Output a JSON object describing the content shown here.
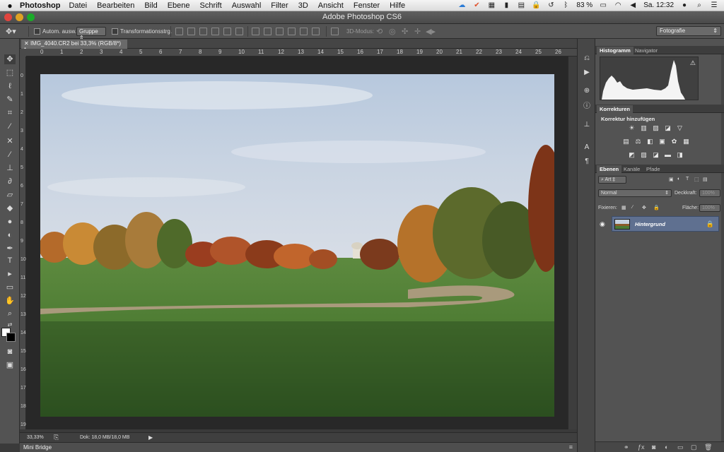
{
  "menubar": {
    "app_name": "Photoshop",
    "items": [
      "Datei",
      "Bearbeiten",
      "Bild",
      "Ebene",
      "Schrift",
      "Auswahl",
      "Filter",
      "3D",
      "Ansicht",
      "Fenster",
      "Hilfe"
    ],
    "battery": "83 %",
    "clock": "Sa. 12:32"
  },
  "titlebar": {
    "title": "Adobe Photoshop CS6"
  },
  "options": {
    "auto_select_label": "Autom. ausw.:",
    "auto_select_mode": "Gruppe",
    "transform_label": "Transformationsstrg.",
    "mode_3d_label": "3D-Modus:",
    "workspace": "Fotografie"
  },
  "document": {
    "tab_title": "IMG_4040.CR2 bei 33,3% (RGB/8*) *",
    "ruler_marks": [
      "0",
      "1",
      "2",
      "3",
      "4",
      "5",
      "6",
      "7",
      "8",
      "9",
      "10",
      "11",
      "12",
      "13",
      "14",
      "15",
      "16",
      "17",
      "18",
      "19",
      "20",
      "21",
      "22",
      "23",
      "24",
      "25",
      "26"
    ],
    "ruler_v_marks": [
      "0",
      "1",
      "2",
      "3",
      "4",
      "5",
      "6",
      "7",
      "8",
      "9",
      "10",
      "11",
      "12",
      "13",
      "14",
      "15",
      "16",
      "17",
      "18",
      "19"
    ]
  },
  "status": {
    "zoom": "33,33%",
    "doc_info": "Dok: 18,0 MB/18,0 MB"
  },
  "minibridge": {
    "label": "Mini Bridge"
  },
  "panels": {
    "histogram_tabs": [
      "Histogramm",
      "Navigator"
    ],
    "corrections_tab": "Korrekturen",
    "corrections_add": "Korrektur hinzufügen",
    "layers_tabs": [
      "Ebenen",
      "Kanäle",
      "Pfade"
    ],
    "filter_kind": "Art",
    "blend_mode": "Normal",
    "opacity_label": "Deckkraft:",
    "opacity_value": "100%",
    "lock_label": "Fixieren:",
    "fill_label": "Fläche:",
    "fill_value": "100%",
    "layer_name": "Hintergrund"
  },
  "colors": {
    "selected_layer": "#5f7090",
    "panel_bg": "#535353"
  }
}
